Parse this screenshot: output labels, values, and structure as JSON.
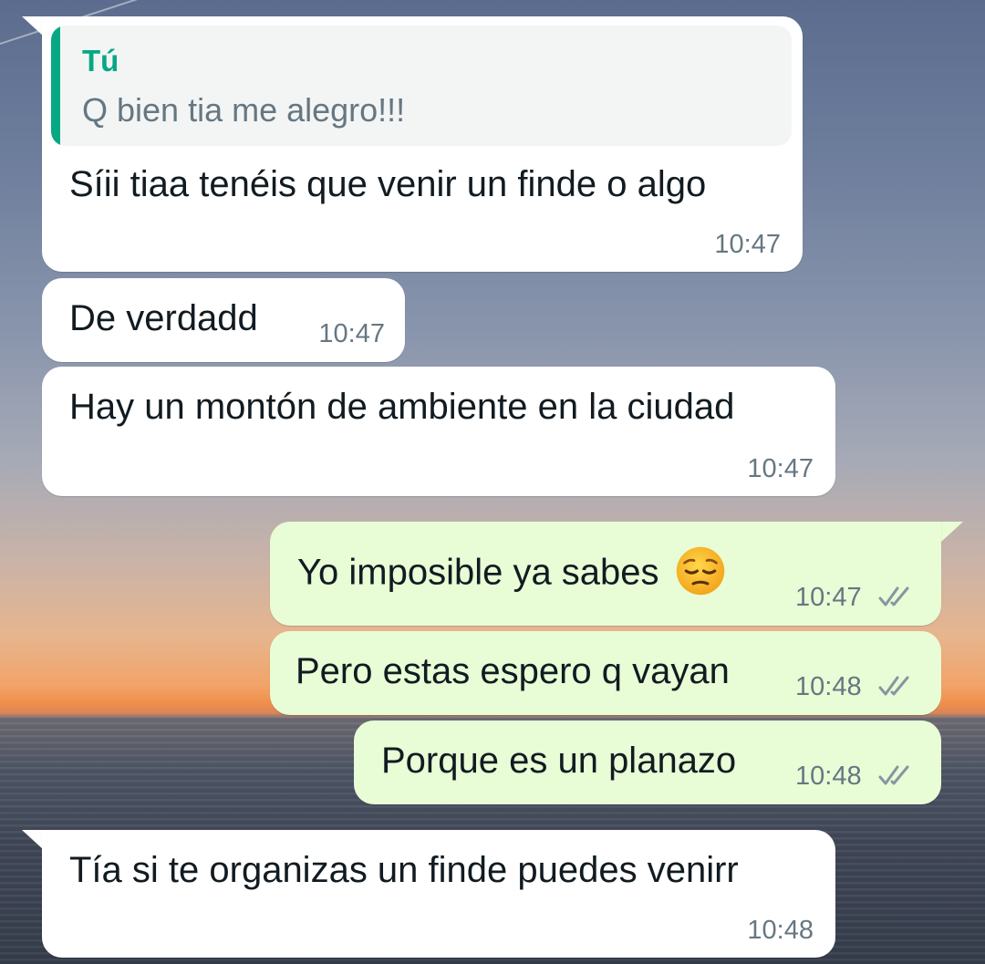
{
  "chat": {
    "messages": [
      {
        "direction": "incoming",
        "quote": {
          "author": "Tú",
          "text": "Q bien tia me alegro!!!"
        },
        "text": "Síii tiaa tenéis que venir un finde o algo",
        "time": "10:47"
      },
      {
        "direction": "incoming",
        "text": "De verdadd",
        "time": "10:47"
      },
      {
        "direction": "incoming",
        "text": "Hay un montón de ambiente en la ciudad",
        "time": "10:47"
      },
      {
        "direction": "outgoing",
        "text": "Yo imposible ya sabes",
        "emoji": "pensive-face",
        "time": "10:47",
        "status": "read"
      },
      {
        "direction": "outgoing",
        "text": "Pero estas espero q vayan",
        "time": "10:48",
        "status": "read"
      },
      {
        "direction": "outgoing",
        "text": "Porque es un planazo",
        "time": "10:48",
        "status": "read"
      },
      {
        "direction": "incoming",
        "text": "Tía si te organizas un finde puedes venirr",
        "time": "10:48"
      }
    ]
  },
  "colors": {
    "incoming_bubble": "#ffffff",
    "outgoing_bubble": "#e8fcd6",
    "quote_accent": "#06a884",
    "timestamp": "#667781",
    "ticks": "#8696a0"
  }
}
